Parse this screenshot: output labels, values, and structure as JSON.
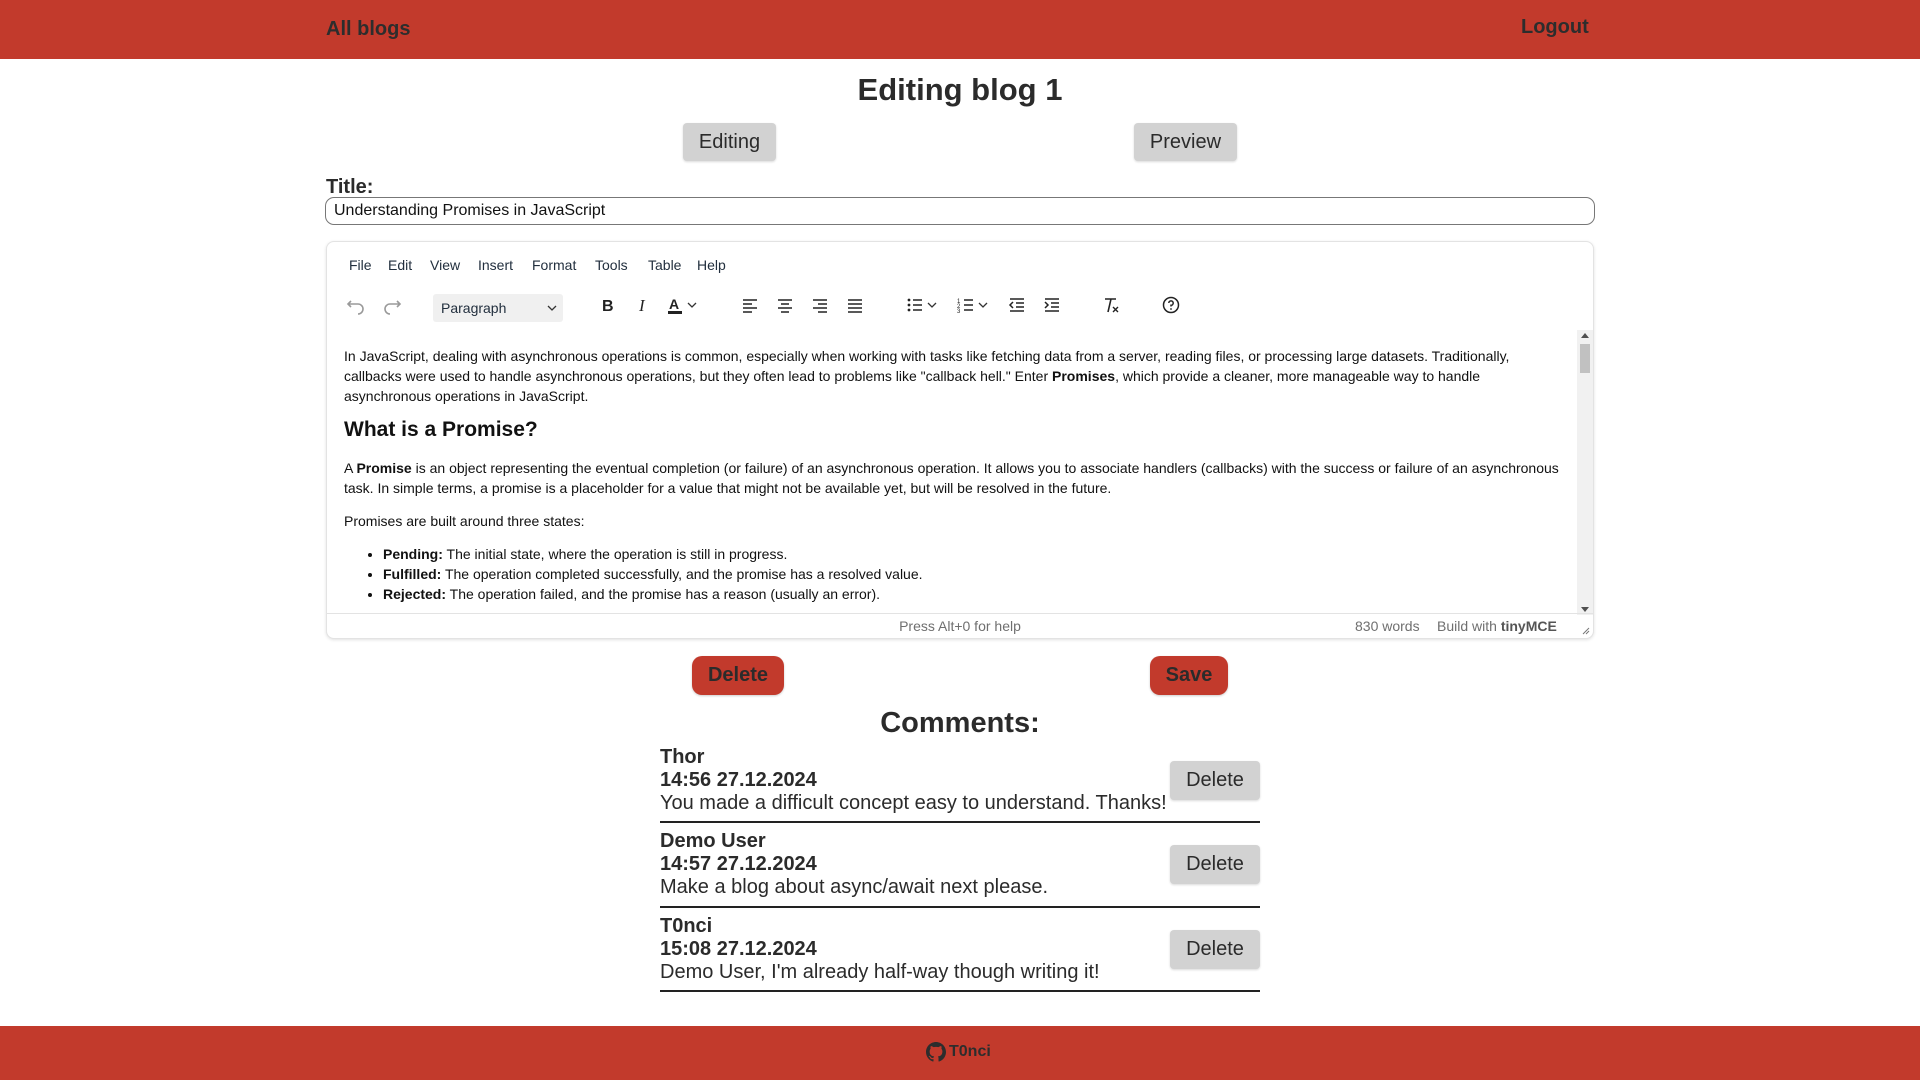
{
  "header": {
    "all_blogs": "All blogs",
    "logout": "Logout"
  },
  "page": {
    "title": "Editing blog 1",
    "mode_editing": "Editing",
    "mode_preview": "Preview"
  },
  "form": {
    "title_label": "Title:",
    "title_value": "Understanding Promises in JavaScript"
  },
  "editor": {
    "menu": [
      "File",
      "Edit",
      "View",
      "Insert",
      "Format",
      "Tools",
      "Table",
      "Help"
    ],
    "block_format": "Paragraph",
    "toolbar_icons": [
      "undo-icon",
      "redo-icon",
      "bold-icon",
      "italic-icon",
      "text-color-icon",
      "align-left-icon",
      "align-center-icon",
      "align-right-icon",
      "justify-icon",
      "bullet-list-icon",
      "numbered-list-icon",
      "outdent-icon",
      "indent-icon",
      "clear-format-icon",
      "help-icon"
    ],
    "content": {
      "p1_a": "In JavaScript, dealing with asynchronous operations is common, especially when working with tasks like fetching data from a server, reading files, or processing large datasets. Traditionally, callbacks were used to handle asynchronous operations, but they often lead to problems like \"callback hell.\" Enter ",
      "p1_bold": "Promises",
      "p1_b": ", which provide a cleaner, more manageable way to handle asynchronous operations in JavaScript.",
      "h2": "What is a Promise?",
      "p2_a": "A ",
      "p2_bold": "Promise",
      "p2_b": " is an object representing the eventual completion (or failure) of an asynchronous operation. It allows you to associate handlers (callbacks) with the success or failure of an asynchronous task. In simple terms, a promise is a placeholder for a value that might not be available yet, but will be resolved in the future.",
      "p3": "Promises are built around three states:",
      "states": [
        {
          "name": "Pending:",
          "desc": " The initial state, where the operation is still in progress."
        },
        {
          "name": "Fulfilled:",
          "desc": " The operation completed successfully, and the promise has a resolved value."
        },
        {
          "name": "Rejected:",
          "desc": " The operation failed, and the promise has a reason (usually an error)."
        }
      ]
    },
    "status": {
      "help": "Press Alt+0 for help",
      "words": "830 words",
      "build_with": "Build with",
      "brand": "tinyMCE"
    }
  },
  "actions": {
    "delete": "Delete",
    "save": "Save"
  },
  "comments": {
    "title": "Comments:",
    "delete_label": "Delete",
    "items": [
      {
        "author": "Thor",
        "time": "14:56 27.12.2024",
        "text": "You made a difficult concept easy to understand. Thanks!"
      },
      {
        "author": "Demo User",
        "time": "14:57 27.12.2024",
        "text": "Make a blog about async/await next please."
      },
      {
        "author": "T0nci",
        "time": "15:08 27.12.2024",
        "text": "Demo User, I'm already half-way though writing it!"
      }
    ]
  },
  "footer": {
    "github_user": "T0nci",
    "icon": "github-icon"
  },
  "colors": {
    "brand_red": "#c23a2c",
    "button_grey": "#d2d2d2"
  }
}
